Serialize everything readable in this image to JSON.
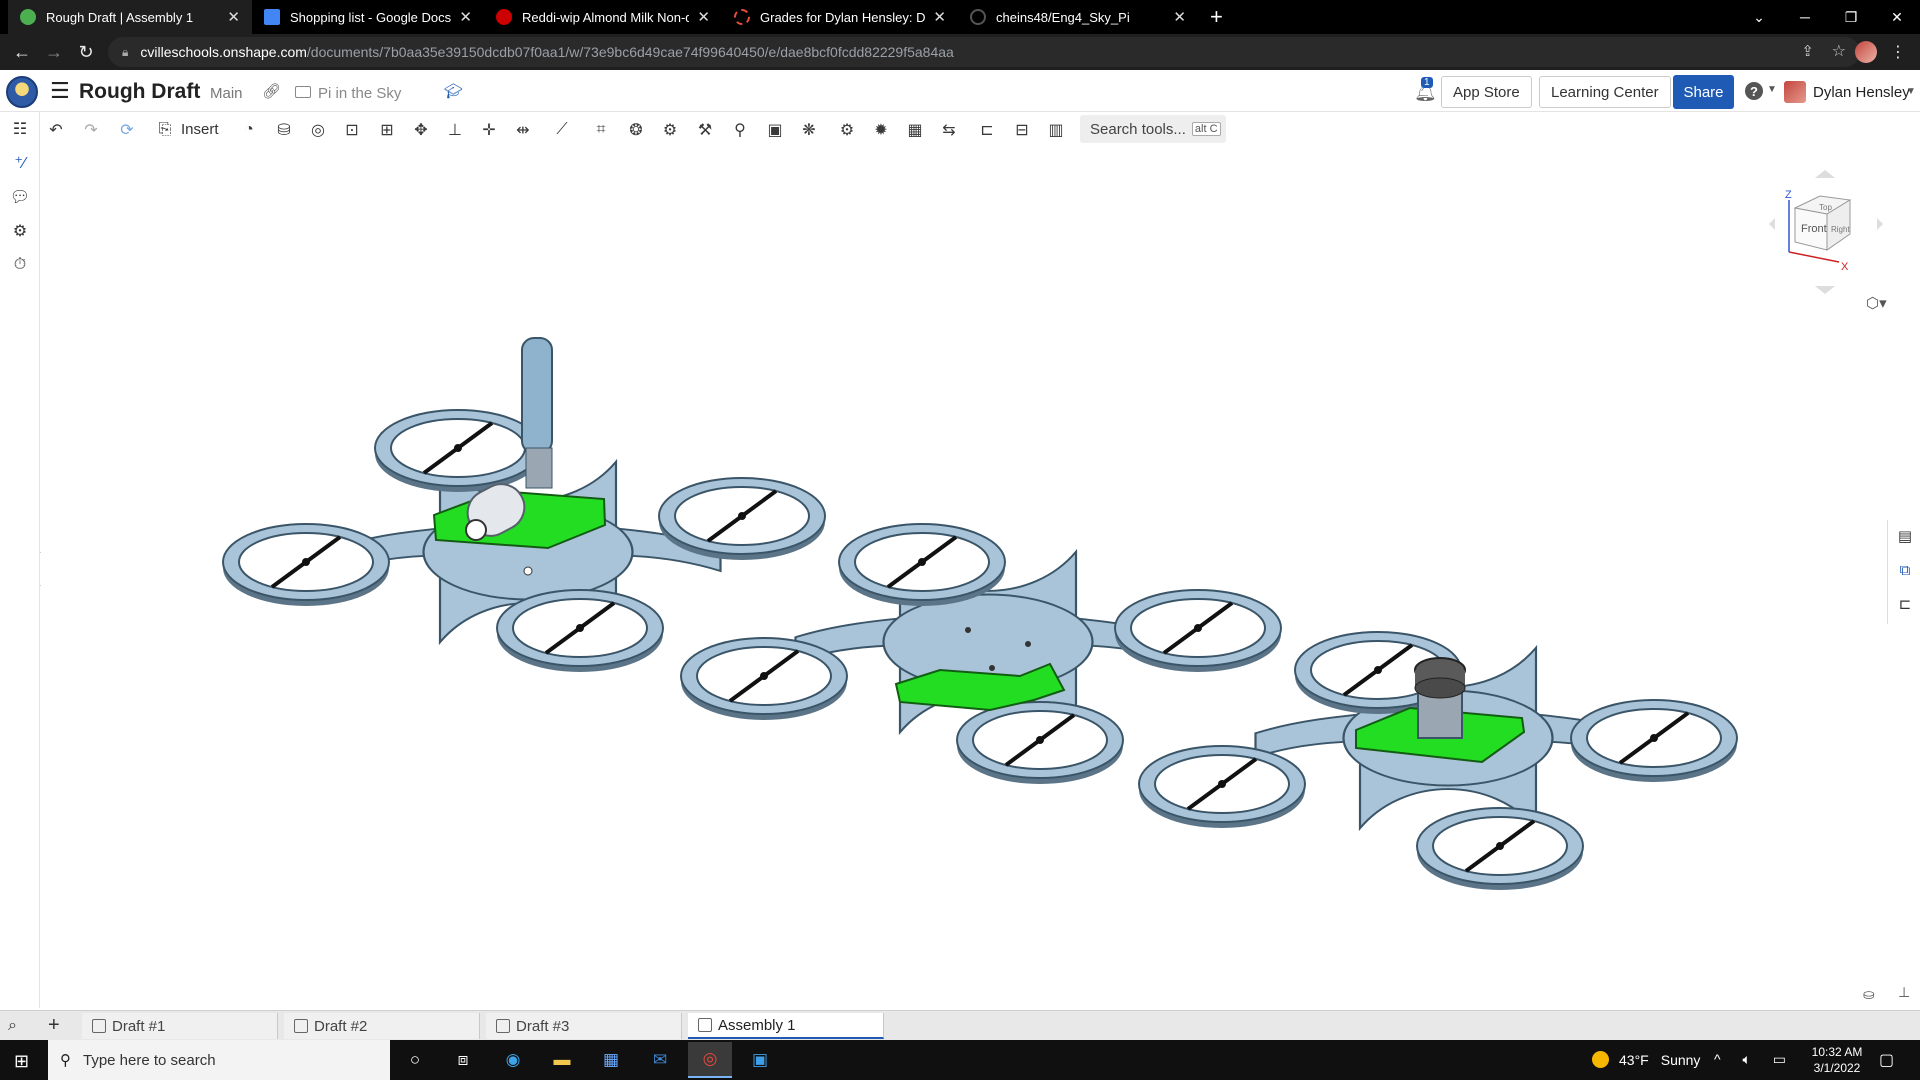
{
  "browser": {
    "tabs": [
      {
        "title": "Rough Draft | Assembly 1",
        "favicon_color": "#4caf50",
        "active": true
      },
      {
        "title": "Shopping list - Google Docs",
        "favicon_color": "#4285f4",
        "active": false
      },
      {
        "title": "Reddi-wip Almond Milk Non-dai",
        "favicon_color": "#cc0000",
        "active": false
      },
      {
        "title": "Grades for Dylan Hensley: DE Enc",
        "favicon_color": "#e74c3c",
        "active": false
      },
      {
        "title": "cheins48/Eng4_Sky_Pi",
        "favicon_color": "#222222",
        "active": false
      }
    ],
    "new_tab": "+",
    "url_host": "cvilleschools.onshape.com",
    "url_path": "/documents/7b0aa35e39150dcdb07f0aa1/w/73e9bc6d49cae74f99640450/e/dae8bcf0fcdd82229f5a84aa"
  },
  "onshape": {
    "doc_title": "Rough Draft",
    "branch": "Main",
    "folder": "Pi in the Sky",
    "notification_count": "1",
    "app_store": "App Store",
    "learning_center": "Learning Center",
    "share": "Share",
    "help": "?",
    "user_name": "Dylan Hensley",
    "insert": "Insert",
    "search_tools": "Search tools...",
    "search_shortcut": "alt C",
    "view_cube": {
      "top": "Top",
      "front": "Front",
      "right": "Right",
      "axis_z": "Z",
      "axis_x": "X"
    }
  },
  "bottom_tabs": [
    {
      "label": "Draft #1",
      "active": false
    },
    {
      "label": "Draft #2",
      "active": false
    },
    {
      "label": "Draft #3",
      "active": false
    },
    {
      "label": "Assembly 1",
      "active": true
    }
  ],
  "taskbar": {
    "search_placeholder": "Type here to search",
    "weather_temp": "43°F",
    "weather_desc": "Sunny",
    "time": "10:32 AM",
    "date": "3/1/2022"
  },
  "colors": {
    "frame_blue": "#a9c3d8",
    "frame_outline": "#3b5568",
    "bracket_green": "#22dd22",
    "accent_blue": "#1f5bb5"
  }
}
